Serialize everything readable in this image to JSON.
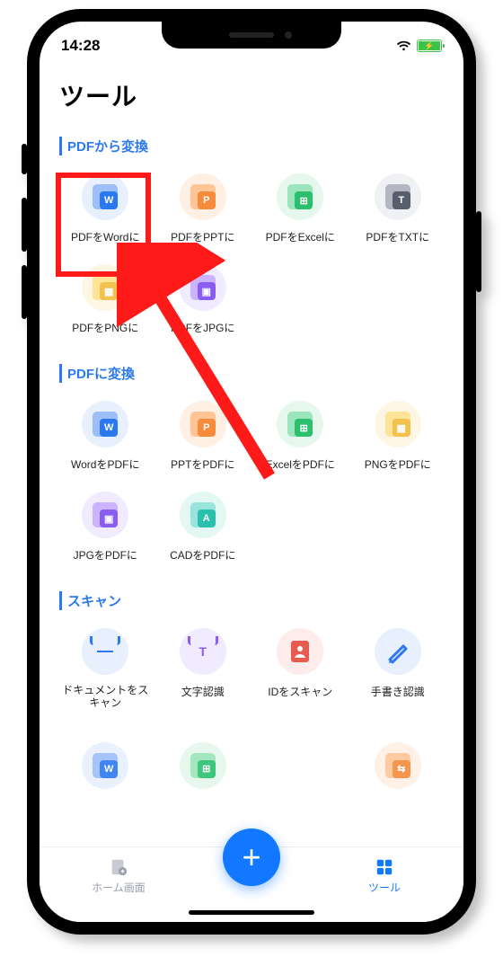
{
  "status": {
    "time": "14:28"
  },
  "page_title": "ツール",
  "sections": [
    {
      "title": "PDFから変換",
      "items": [
        {
          "label": "PDFをWordに",
          "letter": "W",
          "color": "blue",
          "bg": "blue"
        },
        {
          "label": "PDFをPPTに",
          "letter": "P",
          "color": "orange",
          "bg": "orange"
        },
        {
          "label": "PDFをExcelに",
          "letter": "⊞",
          "color": "green",
          "bg": "green"
        },
        {
          "label": "PDFをTXTに",
          "letter": "T",
          "color": "gray",
          "bg": "gray"
        },
        {
          "label": "PDFをPNGに",
          "letter": "▦",
          "color": "yellow",
          "bg": "yellow"
        },
        {
          "label": "PDFをJPGに",
          "letter": "▣",
          "color": "purple",
          "bg": "purple"
        }
      ]
    },
    {
      "title": "PDFに変換",
      "items": [
        {
          "label": "WordをPDFに",
          "letter": "W",
          "color": "blue",
          "bg": "blue"
        },
        {
          "label": "PPTをPDFに",
          "letter": "P",
          "color": "orange",
          "bg": "orange"
        },
        {
          "label": "ExcelをPDFに",
          "letter": "⊞",
          "color": "green",
          "bg": "green"
        },
        {
          "label": "PNGをPDFに",
          "letter": "▦",
          "color": "yellow",
          "bg": "yellow"
        },
        {
          "label": "JPGをPDFに",
          "letter": "▣",
          "color": "purple",
          "bg": "purple"
        },
        {
          "label": "CADをPDFに",
          "letter": "A",
          "color": "teal",
          "bg": "teal"
        }
      ]
    },
    {
      "title": "スキャン",
      "items": [
        {
          "label": "ドキュメントをスキャン",
          "scan": true,
          "color": "blue",
          "bg": "blue",
          "two": true
        },
        {
          "label": "文字認識",
          "scan": true,
          "color": "purple",
          "bg": "purple",
          "inner": "T"
        },
        {
          "label": "IDをスキャン",
          "id": true,
          "color": "red",
          "bg": "red"
        },
        {
          "label": "手書き認識",
          "pen": true,
          "color": "blue",
          "bg": "blue"
        }
      ]
    }
  ],
  "peek_row": [
    {
      "letter": "W",
      "color": "blue",
      "bg": "blue"
    },
    {
      "letter": "⊞",
      "color": "green",
      "bg": "green"
    },
    {
      "letter": "",
      "color": "",
      "bg": ""
    },
    {
      "letter": "⇆",
      "color": "orange",
      "bg": "orange"
    }
  ],
  "bottom_nav": {
    "home": "ホーム画面",
    "tools": "ツール"
  }
}
